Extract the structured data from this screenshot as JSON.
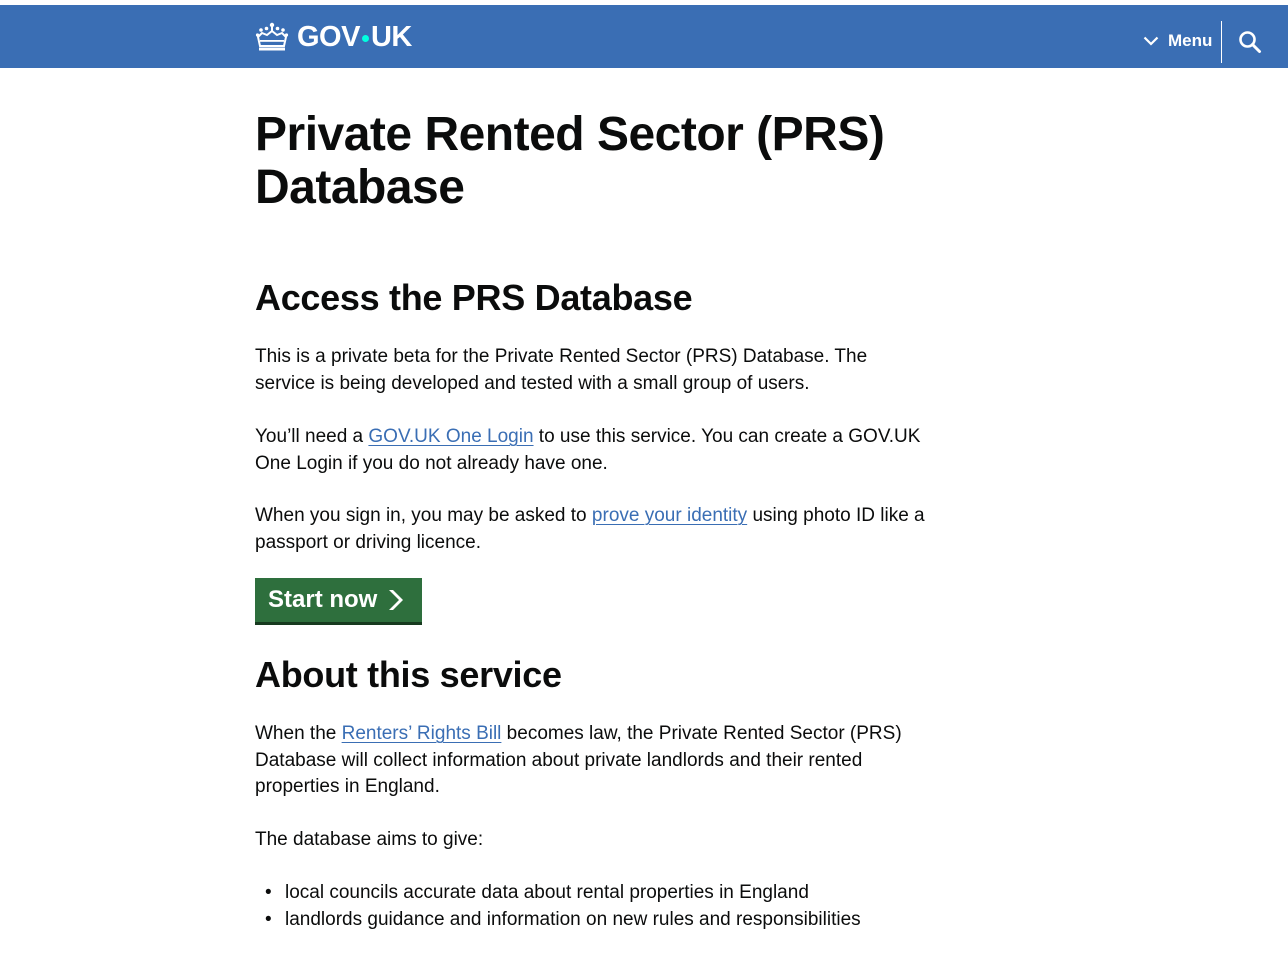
{
  "header": {
    "logo_text_left": "GOV",
    "logo_text_right": "UK",
    "menu_label": "Menu",
    "brand_color": "#3a6eb4",
    "icons": [
      "crown-icon",
      "chevron-down-icon",
      "search-icon"
    ]
  },
  "main": {
    "title": "Private Rented Sector (PRS) Database",
    "access_heading": "Access the PRS Database",
    "intro_paragraph": "This is a private beta for the Private Rented Sector (PRS) Database. The service is being developed and tested with a small group of users.",
    "login_before": "You’ll need a ",
    "login_link": "GOV.UK One Login",
    "login_after": " to use this service. You can create a GOV.UK One Login if you do not already have one.",
    "identity_before": "When you sign in, you may be asked to ",
    "identity_link": "prove your identity",
    "identity_after": " using photo ID like a passport or driving licence.",
    "start_button": "Start now",
    "start_button_color": "#2e6f3d",
    "about_heading": "About this service",
    "about_before": "When the ",
    "about_link": "Renters’ Rights Bill",
    "about_after": " becomes law, the Private Rented Sector (PRS) Database will collect information about private landlords and their rented properties in England.",
    "aims_intro": "The database aims to give:",
    "aims": [
      "local councils accurate data about rental properties in England",
      "landlords guidance and information on new rules and responsibilities"
    ]
  }
}
